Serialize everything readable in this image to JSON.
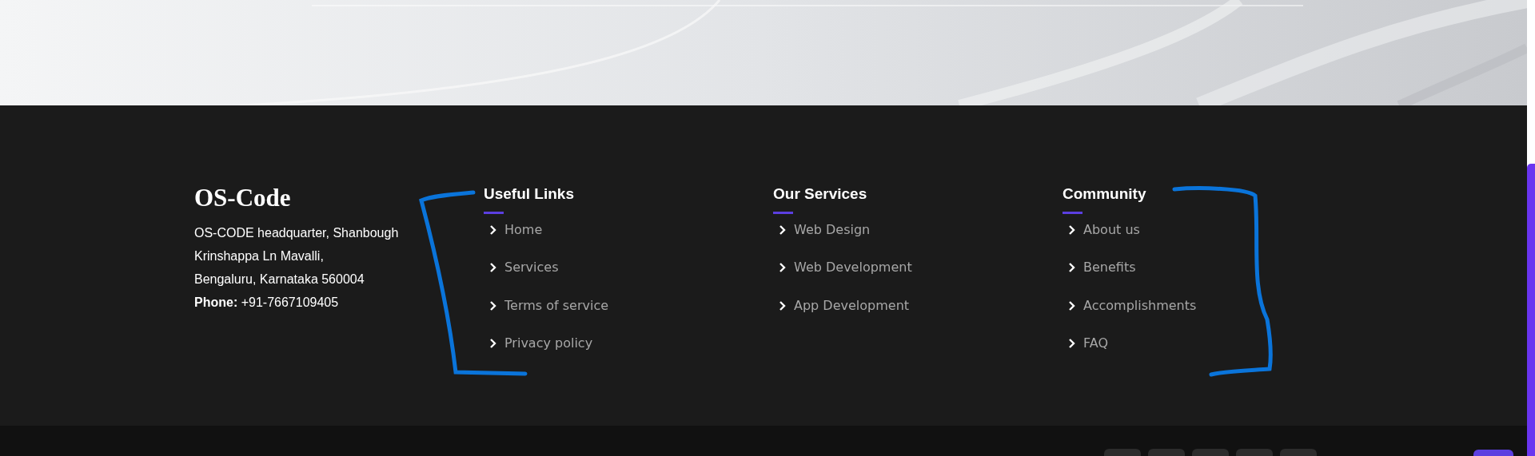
{
  "brand": {
    "title": "OS-Code",
    "address_lines": [
      "OS-CODE headquarter, Shanbough",
      "Krinshappa Ln Mavalli,",
      "Bengaluru, Karnataka 560004"
    ],
    "phone": "**Phone:** +91-7667109405"
  },
  "link_columns": [
    {
      "title": "Useful Links",
      "links": [
        "Home",
        "Services",
        "Terms of service",
        "Privacy policy"
      ]
    },
    {
      "title": "Our Services",
      "links": [
        "Web Design",
        "Web Development",
        "App Development"
      ]
    },
    {
      "title": "Community",
      "links": [
        "About us",
        "Benefits",
        "Accomplishments",
        "FAQ"
      ]
    }
  ]
}
